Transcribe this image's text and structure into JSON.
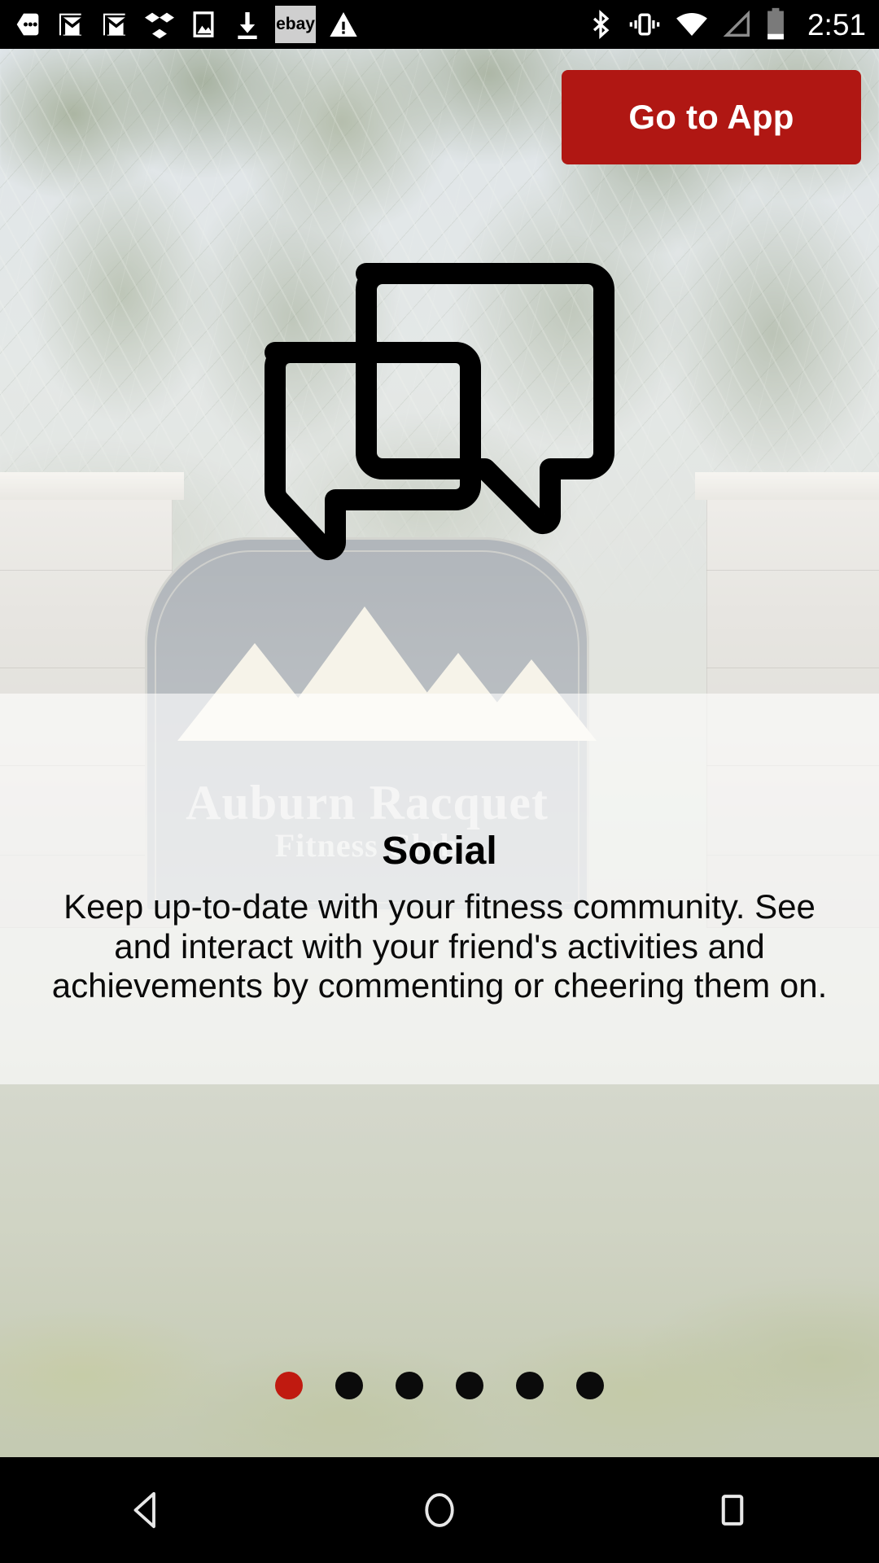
{
  "status_bar": {
    "time": "2:51",
    "left_icons": [
      {
        "name": "messaging-notification-icon",
        "glyph": "dots-badge"
      },
      {
        "name": "gmail-notification-icon",
        "glyph": "gmail"
      },
      {
        "name": "gmail-notification-icon-2",
        "glyph": "gmail"
      },
      {
        "name": "dropbox-notification-icon",
        "glyph": "dropbox"
      },
      {
        "name": "screenshot-notification-icon",
        "glyph": "image"
      },
      {
        "name": "download-notification-icon",
        "glyph": "download-arrow"
      },
      {
        "name": "ebay-notification-icon",
        "glyph": "ebay",
        "label": "ebay"
      },
      {
        "name": "warning-notification-icon",
        "glyph": "warning-triangle"
      }
    ],
    "right_icons": [
      {
        "name": "bluetooth-icon",
        "glyph": "bluetooth"
      },
      {
        "name": "vibrate-mode-icon",
        "glyph": "vibrate"
      },
      {
        "name": "wifi-signal-icon",
        "glyph": "wifi-full"
      },
      {
        "name": "cellular-signal-icon",
        "glyph": "signal-empty"
      },
      {
        "name": "battery-icon",
        "glyph": "battery-low"
      }
    ]
  },
  "header": {
    "go_to_app_label": "Go to App",
    "button_color": "#b01713"
  },
  "main": {
    "icon_name": "chat-bubbles-icon",
    "title": "Social",
    "description": "Keep up-to-date with your fitness community. See and interact with your friend's activities and achievements by commenting or cheering them on."
  },
  "background": {
    "sign_line_1": "Auburn Racquet",
    "sign_line_2": "Fitness Club"
  },
  "pagination": {
    "total": 6,
    "active_index": 0,
    "active_color": "#c01a10",
    "inactive_color": "#0b0b0b"
  },
  "nav_bar": {
    "back_label": "Back",
    "home_label": "Home",
    "recents_label": "Recents"
  }
}
